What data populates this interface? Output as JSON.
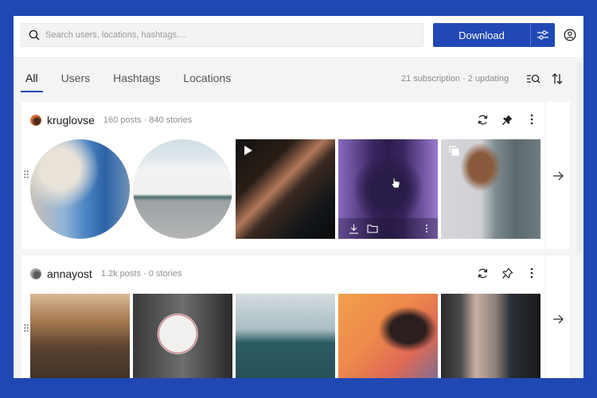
{
  "colors": {
    "accent": "#2148b5",
    "backdrop": "#2048b3"
  },
  "topbar": {
    "search_placeholder": "Search users, locations, hashtags....",
    "search_value": "",
    "download_label": "Download",
    "icons": {
      "search": "search-icon",
      "filter": "sliders-icon",
      "account": "account-circle-icon"
    }
  },
  "tabs": {
    "items": [
      {
        "label": "All",
        "active": true
      },
      {
        "label": "Users",
        "active": false
      },
      {
        "label": "Hashtags",
        "active": false
      },
      {
        "label": "Locations",
        "active": false
      }
    ],
    "subscription_info": "21 subscription · 2 updating",
    "icons": {
      "list_search": "list-search-icon",
      "sort": "sort-icon"
    }
  },
  "subscriptions": [
    {
      "username": "kruglovse",
      "stats": "160 posts · 840 stories",
      "pinned": true,
      "media": [
        {
          "kind": "story",
          "subject": "blue-painted alley"
        },
        {
          "kind": "story",
          "subject": "white houses street"
        },
        {
          "kind": "video",
          "subject": "dark building interior"
        },
        {
          "kind": "photo",
          "subject": "cathedral ceiling",
          "hovered": true,
          "hover_actions": [
            "download",
            "folder",
            "more"
          ]
        },
        {
          "kind": "carousel",
          "subject": "woman in striped shirt"
        }
      ]
    },
    {
      "username": "annayost",
      "stats": "1.2k posts · 0 stories",
      "pinned": false,
      "media": [
        {
          "kind": "photo",
          "subject": "city street at sunset"
        },
        {
          "kind": "photo",
          "subject": "ajax sign"
        },
        {
          "kind": "photo",
          "subject": "foggy sea pier"
        },
        {
          "kind": "photo",
          "subject": "woman orange background"
        },
        {
          "kind": "photo",
          "subject": "newsstand kiosk"
        }
      ]
    }
  ]
}
